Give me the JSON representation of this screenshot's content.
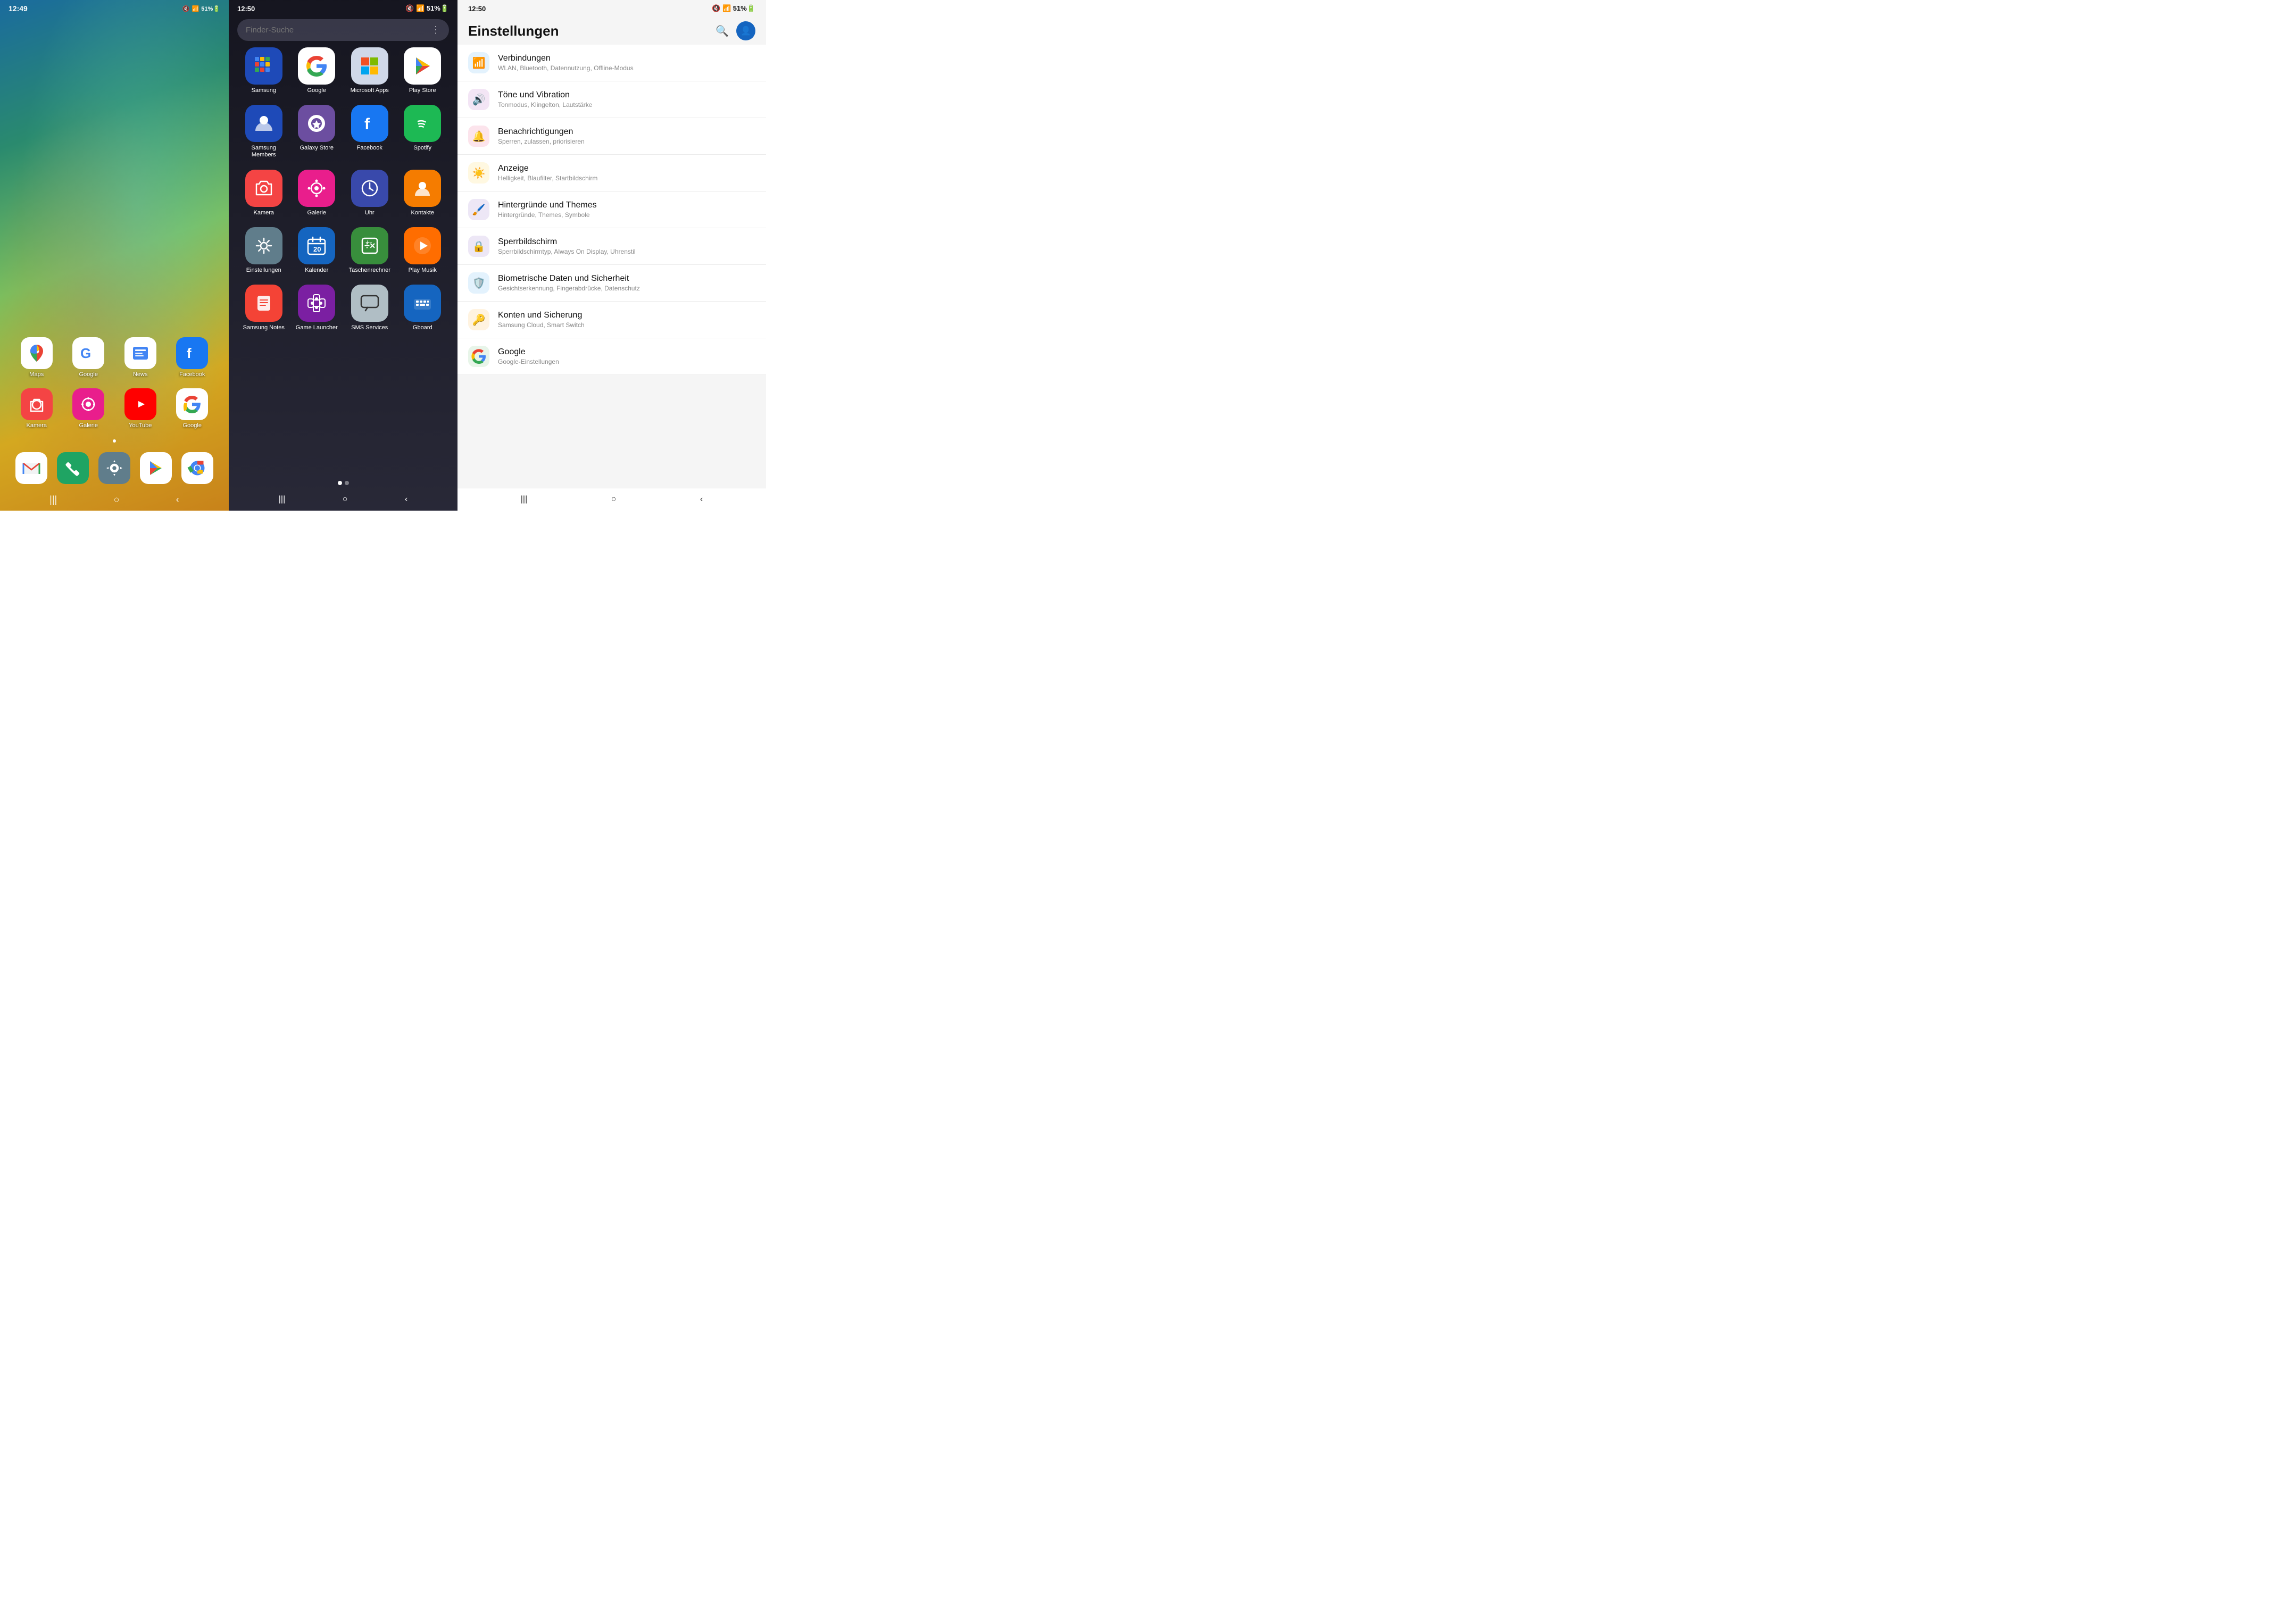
{
  "panel1": {
    "time": "12:49",
    "status": "🔕 📶 51% 🔋",
    "row1": [
      {
        "label": "Maps",
        "icon": "maps",
        "bg": "#fff"
      },
      {
        "label": "Google",
        "icon": "google",
        "bg": "#fff"
      },
      {
        "label": "News",
        "icon": "news",
        "bg": "#fff"
      },
      {
        "label": "Facebook",
        "icon": "facebook",
        "bg": "#1877f2"
      }
    ],
    "row2": [
      {
        "label": "Kamera",
        "icon": "camera",
        "bg": "#f44"
      },
      {
        "label": "Galerie",
        "icon": "galerie",
        "bg": "#e91e8c"
      },
      {
        "label": "YouTube",
        "icon": "youtube",
        "bg": "#f00"
      },
      {
        "label": "Google",
        "icon": "google-color",
        "bg": "#fff"
      }
    ],
    "dock": [
      {
        "label": "Mail",
        "icon": "gmail",
        "bg": "#fff"
      },
      {
        "label": "Phone",
        "icon": "phone",
        "bg": "#1fa463"
      },
      {
        "label": "Settings",
        "icon": "settings",
        "bg": "#607d8b"
      },
      {
        "label": "Play Store",
        "icon": "playstore",
        "bg": "#fff"
      },
      {
        "label": "Chrome",
        "icon": "chrome",
        "bg": "#fff"
      }
    ],
    "nav": [
      "|||",
      "○",
      "<"
    ]
  },
  "panel2": {
    "time": "12:50",
    "status": "🔕 📶 51% 🔋",
    "search_placeholder": "Finder-Suche",
    "rows": [
      [
        {
          "label": "Samsung",
          "icon": "samsung",
          "bg": "#1e4ab8"
        },
        {
          "label": "Google",
          "icon": "google",
          "bg": "#fff"
        },
        {
          "label": "Microsoft Apps",
          "icon": "microsoft",
          "bg": "#d0d8e8"
        },
        {
          "label": "Play Store",
          "icon": "playstore",
          "bg": "#fff"
        }
      ],
      [
        {
          "label": "Samsung Members",
          "icon": "samsung-members",
          "bg": "#1e4ab8"
        },
        {
          "label": "Galaxy Store",
          "icon": "galaxy-store",
          "bg": "#6c4ea0"
        },
        {
          "label": "Facebook",
          "icon": "facebook",
          "bg": "#1877f2"
        },
        {
          "label": "Spotify",
          "icon": "spotify",
          "bg": "#1db954"
        }
      ],
      [
        {
          "label": "Kamera",
          "icon": "camera",
          "bg": "#f44"
        },
        {
          "label": "Galerie",
          "icon": "galerie",
          "bg": "#e91e8c"
        },
        {
          "label": "Uhr",
          "icon": "uhr",
          "bg": "#3949ab"
        },
        {
          "label": "Kontakte",
          "icon": "kontakte",
          "bg": "#f57c00"
        }
      ],
      [
        {
          "label": "Einstellungen",
          "icon": "settings",
          "bg": "#607d8b"
        },
        {
          "label": "Kalender",
          "icon": "kalender",
          "bg": "#1565c0"
        },
        {
          "label": "Taschenrechner",
          "icon": "rechner",
          "bg": "#388e3c"
        },
        {
          "label": "Play Musik",
          "icon": "play-musik",
          "bg": "#ff6d00"
        }
      ],
      [
        {
          "label": "Samsung Notes",
          "icon": "notes",
          "bg": "#f44336"
        },
        {
          "label": "Game Launcher",
          "icon": "game",
          "bg": "#7b1fa2"
        },
        {
          "label": "SMS Services",
          "icon": "sms",
          "bg": "#b0bec5"
        },
        {
          "label": "Gboard",
          "icon": "gboard",
          "bg": "#1565c0"
        }
      ]
    ],
    "page_dots": [
      true,
      false
    ],
    "nav": [
      "|||",
      "○",
      "<"
    ]
  },
  "panel3": {
    "time": "12:50",
    "status": "🔕 📶 51% 🔋",
    "title": "Einstellungen",
    "items": [
      {
        "icon": "wifi",
        "color": "sic-wifi",
        "title": "Verbindungen",
        "sub": "WLAN, Bluetooth, Datennutzung, Offline-Modus"
      },
      {
        "icon": "sound",
        "color": "sic-sound",
        "title": "Töne und Vibration",
        "sub": "Tonmodus, Klingelton, Lautstärke"
      },
      {
        "icon": "bell",
        "color": "sic-notif",
        "title": "Benachrichtigungen",
        "sub": "Sperren, zulassen, priorisieren"
      },
      {
        "icon": "sun",
        "color": "sic-display",
        "title": "Anzeige",
        "sub": "Helligkeit, Blaufilter, Startbildschirm"
      },
      {
        "icon": "palette",
        "color": "sic-wallpaper",
        "title": "Hintergründe und Themes",
        "sub": "Hintergründe, Themes, Symbole"
      },
      {
        "icon": "lock",
        "color": "sic-lock",
        "title": "Sperrbildschirm",
        "sub": "Sperrbildschirmtyp, Always On Display, Uhrenstil"
      },
      {
        "icon": "shield",
        "color": "sic-bio",
        "title": "Biometrische Daten und Sicherheit",
        "sub": "Gesichtserkennung, Fingerabdrücke, Datenschutz"
      },
      {
        "icon": "key",
        "color": "sic-accounts",
        "title": "Konten und Sicherung",
        "sub": "Samsung Cloud, Smart Switch"
      },
      {
        "icon": "google-g",
        "color": "sic-google",
        "title": "Google",
        "sub": "Google-Einstellungen"
      }
    ],
    "nav": [
      "|||",
      "○",
      "<"
    ]
  }
}
